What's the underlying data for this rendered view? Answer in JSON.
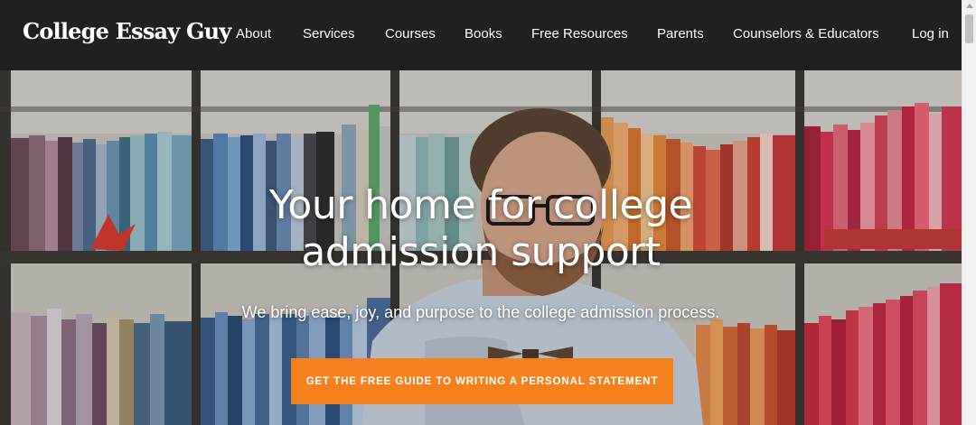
{
  "brand": {
    "logo_text": "College Essay Guy"
  },
  "nav": {
    "items": [
      {
        "label": "About"
      },
      {
        "label": "Services"
      },
      {
        "label": "Courses"
      },
      {
        "label": "Books"
      },
      {
        "label": "Free Resources"
      },
      {
        "label": "Parents"
      },
      {
        "label": "Counselors & Educators"
      },
      {
        "label": "Log in"
      }
    ]
  },
  "hero": {
    "title_line1": "Your home for college",
    "title_line2": "admission support",
    "subtitle": "We bring ease, joy, and purpose to the college admission process.",
    "cta_label": "GET THE FREE GUIDE TO WRITING A PERSONAL STATEMENT"
  },
  "colors": {
    "nav_bg": "#202020",
    "cta_bg": "#f5811e",
    "text": "#ffffff"
  }
}
